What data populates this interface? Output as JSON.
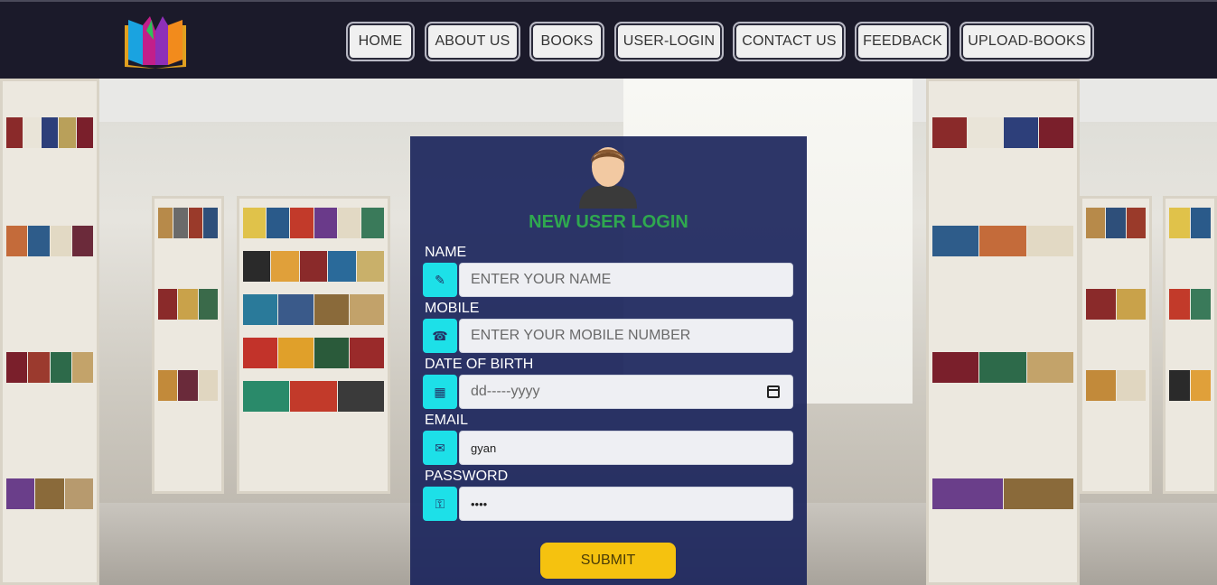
{
  "nav": {
    "items": [
      {
        "label": "HOME"
      },
      {
        "label": "ABOUT US"
      },
      {
        "label": "BOOKS"
      },
      {
        "label": "USER-LOGIN"
      },
      {
        "label": "CONTACT US"
      },
      {
        "label": "FEEDBACK"
      },
      {
        "label": "UPLOAD-BOOKS"
      }
    ]
  },
  "form": {
    "title": "NEW USER LOGIN",
    "fields": {
      "name": {
        "label": "NAME",
        "placeholder": "ENTER YOUR NAME",
        "value": "",
        "icon": "pencil-icon"
      },
      "mobile": {
        "label": "MOBILE",
        "placeholder": "ENTER YOUR MOBILE NUMBER",
        "value": "",
        "icon": "phone-icon"
      },
      "dob": {
        "label": "DATE OF BIRTH",
        "placeholder": "dd-----yyyy",
        "value": "",
        "icon": "calendar-icon"
      },
      "email": {
        "label": "EMAIL",
        "placeholder": "",
        "value": "gyan",
        "icon": "envelope-icon"
      },
      "password": {
        "label": "PASSWORD",
        "placeholder": "",
        "value": "••••",
        "icon": "lock-icon"
      }
    },
    "submit_label": "SUBMIT"
  },
  "colors": {
    "header_bg": "#1b1a2a",
    "panel_bg": "#1b255c",
    "title_green": "#2fa84f",
    "icon_cyan": "#1de0e8",
    "submit_yellow": "#f5c20f"
  }
}
